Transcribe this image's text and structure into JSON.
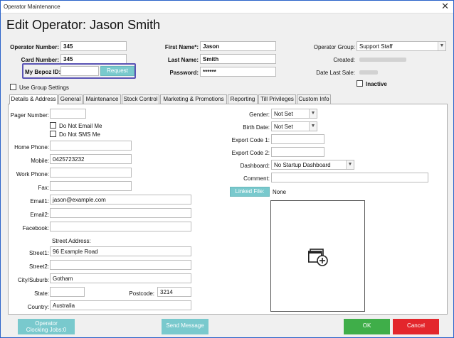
{
  "window": {
    "title": "Operator Maintenance",
    "close_glyph": "✕"
  },
  "page_title": "Edit Operator: Jason Smith",
  "header": {
    "operator_number_label": "Operator Number:",
    "operator_number": "345",
    "card_number_label": "Card Number:",
    "card_number": "345",
    "bepoz_id_label": "My Bepoz ID:",
    "bepoz_id": "",
    "request_label": "Request",
    "first_name_label": "First Name*:",
    "first_name": "Jason",
    "last_name_label": "Last Name:",
    "last_name": "Smith",
    "password_label": "Password:",
    "password": "******",
    "operator_group_label": "Operator Group:",
    "operator_group": "Support Staff",
    "created_label": "Created:",
    "date_last_sale_label": "Date Last Sale:",
    "inactive_label": "Inactive",
    "use_group_settings_label": "Use Group Settings"
  },
  "tabs": [
    {
      "label": "Details & Address"
    },
    {
      "label": "General"
    },
    {
      "label": "Maintenance"
    },
    {
      "label": "Stock Control"
    },
    {
      "label": "Marketing & Promotions"
    },
    {
      "label": "Reporting"
    },
    {
      "label": "Till Privileges"
    },
    {
      "label": "Custom Info"
    }
  ],
  "details": {
    "pager_number_label": "Pager Number:",
    "pager_number": "",
    "do_not_email_label": "Do Not Email Me",
    "do_not_sms_label": "Do Not SMS Me",
    "home_phone_label": "Home Phone:",
    "home_phone": "",
    "mobile_label": "Mobile:",
    "mobile": "0425723232",
    "work_phone_label": "Work Phone:",
    "work_phone": "",
    "fax_label": "Fax:",
    "fax": "",
    "email1_label": "Email1:",
    "email1": "jason@example.com",
    "email2_label": "Email2:",
    "email2": "",
    "facebook_label": "Facebook:",
    "facebook": "",
    "street_address_label": "Street Address:",
    "street1_label": "Street1:",
    "street1": "96 Example Road",
    "street2_label": "Street2:",
    "street2": "",
    "city_label": "City/Suburb:",
    "city": "Gotham",
    "state_label": "State:",
    "state": "",
    "postcode_label": "Postcode:",
    "postcode": "3214",
    "country_label": "Country:",
    "country": "Australia",
    "gender_label": "Gender:",
    "gender": "Not Set",
    "birth_date_label": "Birth Date:",
    "birth_date": "Not Set",
    "export_code1_label": "Export Code 1:",
    "export_code1": "",
    "export_code2_label": "Export Code 2:",
    "export_code2": "",
    "dashboard_label": "Dashboard:",
    "dashboard": "No Startup Dashboard",
    "comment_label": "Comment:",
    "comment": "",
    "linked_file_label": "Linked File:",
    "linked_file": "None",
    "photo_icon": "add-image-icon"
  },
  "footer": {
    "operator_clocking_line1": "Operator",
    "operator_clocking_line2": "Clocking Jobs:0",
    "send_message": "Send Message",
    "ok": "OK",
    "cancel": "Cancel"
  },
  "colors": {
    "teal": "#79c9cd",
    "ok_green": "#3fae49",
    "cancel_red": "#e3262c",
    "highlight_border": "#5a54b5",
    "window_border": "#2a62c9"
  }
}
